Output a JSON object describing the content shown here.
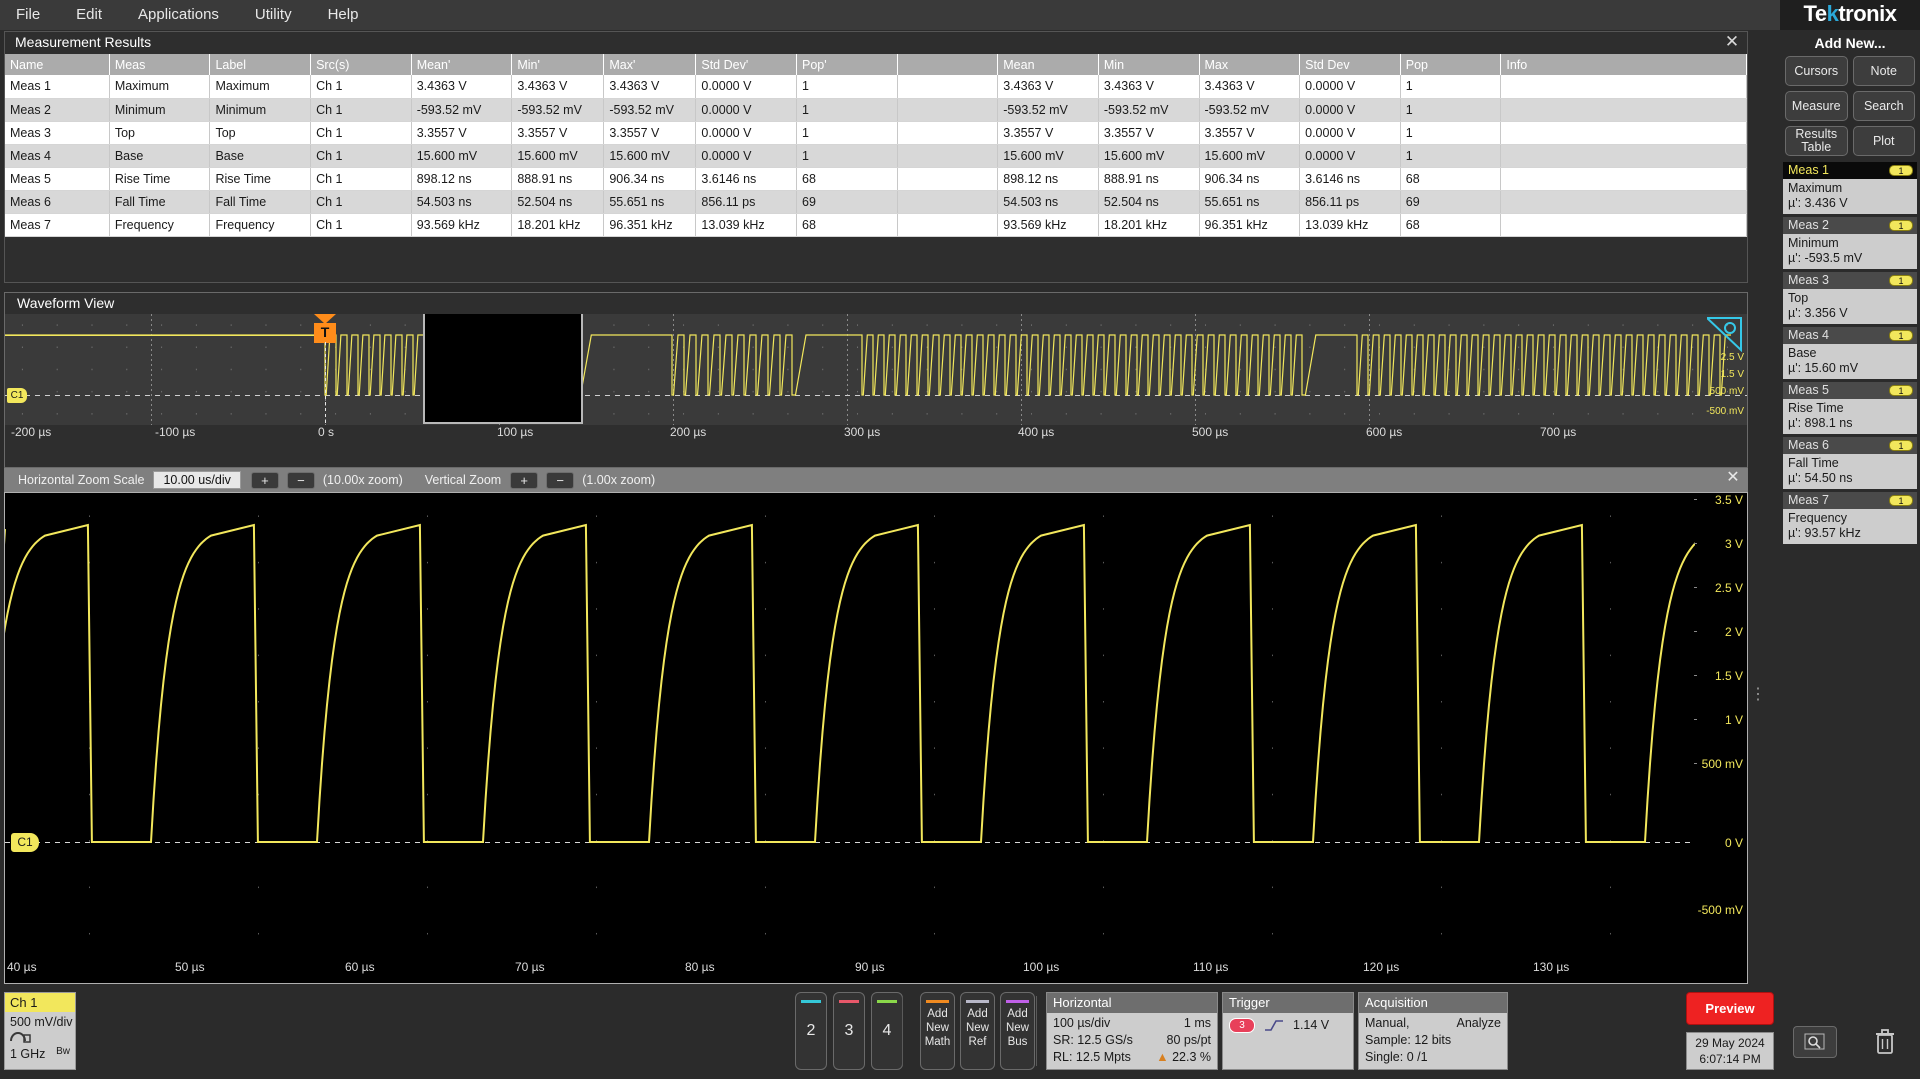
{
  "menubar": {
    "items": [
      "File",
      "Edit",
      "Applications",
      "Utility",
      "Help"
    ]
  },
  "results": {
    "title": "Measurement Results",
    "close_icon": "close-icon",
    "columns": [
      "Name",
      "Meas",
      "Label",
      "Src(s)",
      "Mean'",
      "Min'",
      "Max'",
      "Std Dev'",
      "Pop'",
      "",
      "Mean",
      "Min",
      "Max",
      "Std Dev",
      "Pop",
      "Info"
    ],
    "rows": [
      [
        "Meas 1",
        "Maximum",
        "Maximum",
        "Ch 1",
        "3.4363 V",
        "3.4363 V",
        "3.4363 V",
        "0.0000 V",
        "1",
        "",
        "3.4363 V",
        "3.4363 V",
        "3.4363 V",
        "0.0000 V",
        "1",
        ""
      ],
      [
        "Meas 2",
        "Minimum",
        "Minimum",
        "Ch 1",
        "-593.52 mV",
        "-593.52 mV",
        "-593.52 mV",
        "0.0000 V",
        "1",
        "",
        "-593.52 mV",
        "-593.52 mV",
        "-593.52 mV",
        "0.0000 V",
        "1",
        ""
      ],
      [
        "Meas 3",
        "Top",
        "Top",
        "Ch 1",
        "3.3557 V",
        "3.3557 V",
        "3.3557 V",
        "0.0000 V",
        "1",
        "",
        "3.3557 V",
        "3.3557 V",
        "3.3557 V",
        "0.0000 V",
        "1",
        ""
      ],
      [
        "Meas 4",
        "Base",
        "Base",
        "Ch 1",
        "15.600 mV",
        "15.600 mV",
        "15.600 mV",
        "0.0000 V",
        "1",
        "",
        "15.600 mV",
        "15.600 mV",
        "15.600 mV",
        "0.0000 V",
        "1",
        ""
      ],
      [
        "Meas 5",
        "Rise Time",
        "Rise Time",
        "Ch 1",
        "898.12 ns",
        "888.91 ns",
        "906.34 ns",
        "3.6146 ns",
        "68",
        "",
        "898.12 ns",
        "888.91 ns",
        "906.34 ns",
        "3.6146 ns",
        "68",
        ""
      ],
      [
        "Meas 6",
        "Fall Time",
        "Fall Time",
        "Ch 1",
        "54.503 ns",
        "52.504 ns",
        "55.651 ns",
        "856.11 ps",
        "69",
        "",
        "54.503 ns",
        "52.504 ns",
        "55.651 ns",
        "856.11 ps",
        "69",
        ""
      ],
      [
        "Meas 7",
        "Frequency",
        "Frequency",
        "Ch 1",
        "93.569 kHz",
        "18.201 kHz",
        "96.351 kHz",
        "13.039 kHz",
        "68",
        "",
        "93.569 kHz",
        "18.201 kHz",
        "96.351 kHz",
        "13.039 kHz",
        "68",
        ""
      ]
    ]
  },
  "waveform_view": {
    "title": "Waveform View",
    "channel_badge": "C1",
    "trigger_label": "T",
    "time_ticks": [
      "-200 µs",
      "-100 µs",
      "0 s",
      "100 µs",
      "200 µs",
      "300 µs",
      "400 µs",
      "500 µs",
      "600 µs",
      "700 µs"
    ],
    "volt_ticks_right": [
      "2.5 V",
      "1.5 V",
      "500 mV",
      "-500 mV"
    ]
  },
  "zoom_controls": {
    "horizontal_label": "Horizontal Zoom Scale",
    "horizontal_value": "10.00 us/div",
    "plus_label": "+",
    "minus_label": "−",
    "horizontal_factor": "(10.00x zoom)",
    "vertical_label": "Vertical Zoom",
    "vertical_factor": "(1.00x zoom)",
    "close_icon": "close-icon"
  },
  "main_waveform": {
    "channel_badge": "C1",
    "volt_ticks": [
      "3.5 V",
      "3 V",
      "2.5 V",
      "2 V",
      "1.5 V",
      "1 V",
      "500 mV",
      "0 V",
      "-500 mV"
    ],
    "time_ticks": [
      "40 µs",
      "50 µs",
      "60 µs",
      "70 µs",
      "80 µs",
      "90 µs",
      "100 µs",
      "110 µs",
      "120 µs",
      "130 µs"
    ]
  },
  "sidebar": {
    "brand": "Tektronix",
    "add_new_title": "Add New...",
    "add_new_buttons": [
      "Cursors",
      "Note",
      "Measure",
      "Search",
      "Results Table",
      "Plot"
    ],
    "badges": [
      {
        "name": "Meas 1",
        "source": "1",
        "meas": "Maximum",
        "value": "µ': 3.436 V",
        "selected": true
      },
      {
        "name": "Meas 2",
        "source": "1",
        "meas": "Minimum",
        "value": "µ': -593.5 mV",
        "selected": false
      },
      {
        "name": "Meas 3",
        "source": "1",
        "meas": "Top",
        "value": "µ': 3.356 V",
        "selected": false
      },
      {
        "name": "Meas 4",
        "source": "1",
        "meas": "Base",
        "value": "µ': 15.60 mV",
        "selected": false
      },
      {
        "name": "Meas 5",
        "source": "1",
        "meas": "Rise Time",
        "value": "µ': 898.1 ns",
        "selected": false
      },
      {
        "name": "Meas 6",
        "source": "1",
        "meas": "Fall Time",
        "value": "µ': 54.50 ns",
        "selected": false
      },
      {
        "name": "Meas 7",
        "source": "1",
        "meas": "Frequency",
        "value": "µ': 93.57 kHz",
        "selected": false
      }
    ],
    "bottom_icons": [
      "zoom-icon",
      "trash-icon"
    ]
  },
  "bottombar": {
    "channel": {
      "name": "Ch 1",
      "scale": "500 mV/div",
      "coupling_icon": "dc-coupling-icon",
      "bandwidth": "1 GHz",
      "bw_sub": "Bw"
    },
    "channel_buttons": [
      {
        "label": "2",
        "color": "#35c8d8"
      },
      {
        "label": "3",
        "color": "#e8586a"
      },
      {
        "label": "4",
        "color": "#8ad84a"
      }
    ],
    "add_buttons": [
      {
        "label": "Add New Math",
        "color": "#f08a20"
      },
      {
        "label": "Add New Ref",
        "color": "#b8b8c8"
      },
      {
        "label": "Add New Bus",
        "color": "#c060e8"
      }
    ],
    "horizontal": {
      "title": "Horizontal",
      "scale": "100 µs/div",
      "span": "1 ms",
      "sample_rate": "SR: 12.5 GS/s",
      "resolution": "80 ps/pt",
      "record_length": "RL: 12.5 Mpts",
      "position": "22.3 %",
      "position_icon": "trigger-position-icon"
    },
    "trigger": {
      "title": "Trigger",
      "source": "3",
      "edge_icon": "rising-edge-icon",
      "level": "1.14 V"
    },
    "acquisition": {
      "title": "Acquisition",
      "mode": "Manual,",
      "analyze": "Analyze",
      "sample": "Sample: 12 bits",
      "single": "Single: 0 /1"
    },
    "preview_label": "Preview",
    "date": "29 May 2024",
    "time": "6:07:14 PM"
  }
}
